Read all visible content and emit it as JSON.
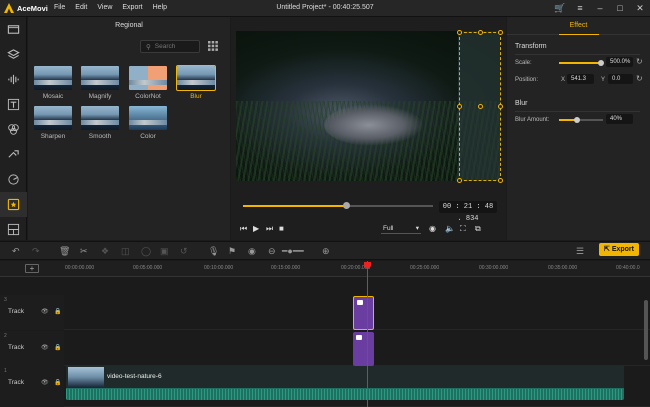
{
  "app": {
    "name": "AceMovi",
    "window_title": "Untitled Project* - 00:40:25.507"
  },
  "menu": [
    "File",
    "Edit",
    "View",
    "Export",
    "Help"
  ],
  "sidebar": {
    "items": [
      "media-icon",
      "layers-icon",
      "audio-icon",
      "text-icon",
      "filters-icon",
      "transitions-icon",
      "overlay-icon",
      "effects-icon",
      "split-screen-icon"
    ],
    "active_index": 7
  },
  "regional": {
    "title": "Regional",
    "search_placeholder": "Search",
    "effects": [
      {
        "label": "Mosaic",
        "selected": false
      },
      {
        "label": "Magnify",
        "selected": false
      },
      {
        "label": "ColorNot",
        "selected": false
      },
      {
        "label": "Blur",
        "selected": true
      },
      {
        "label": "Sharpen",
        "selected": false
      },
      {
        "label": "Smooth",
        "selected": false
      },
      {
        "label": "Color",
        "selected": false
      }
    ]
  },
  "player": {
    "timecode": "00 : 21 : 48 . 834",
    "progress": 0.54,
    "quality": "Full"
  },
  "effect_panel": {
    "tab": "Effect",
    "transform": {
      "title": "Transform",
      "scale_label": "Scale:",
      "scale_value": "500.0%",
      "scale_level": 0.95,
      "position_label": "Position:",
      "x_label": "X",
      "x_value": "541.3",
      "y_label": "Y",
      "y_value": "0.0"
    },
    "blur": {
      "title": "Blur",
      "amount_label": "Blur Amount:",
      "amount_value": "40%",
      "amount_level": 0.4
    }
  },
  "toolbar": {
    "export_label": "Export"
  },
  "timeline": {
    "ruler": [
      "00:00:00.000",
      "00:05:00.000",
      "00:10:00.000",
      "00:15:00.000",
      "00:20:00.000",
      "00:25:00.000",
      "00:30:00.000",
      "00:35:00.000",
      "00:40:00.0"
    ],
    "tracks": [
      {
        "num": "3",
        "name": "Track"
      },
      {
        "num": "2",
        "name": "Track"
      },
      {
        "num": "1",
        "name": "Track"
      }
    ],
    "video_clip_label": "video-test-nature-6"
  },
  "colors": {
    "accent": "#f2b600",
    "clip_purple": "#6a3ea0",
    "clip_teal": "#1e7060",
    "playhead": "#e22222"
  }
}
